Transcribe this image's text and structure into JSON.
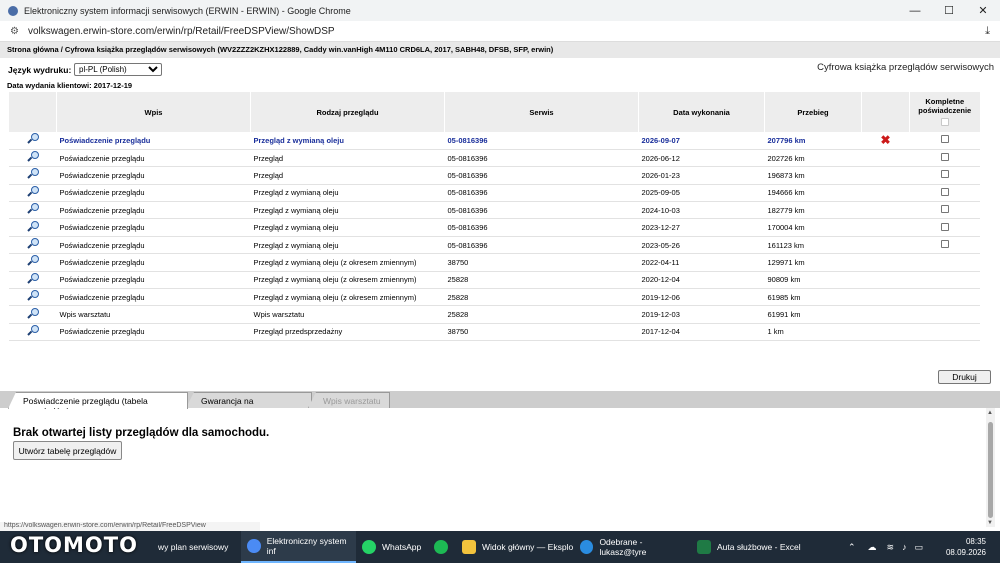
{
  "window": {
    "title": "Elektroniczny system informacji serwisowych (ERWIN - ERWIN) - Google Chrome",
    "controls": {
      "minimize": "—",
      "maximize": "☐",
      "close": "✕"
    }
  },
  "address": {
    "url": "volkswagen.erwin-store.com/erwin/rp/Retail/FreeDSPView/ShowDSP"
  },
  "breadcrumb": "Strona główna / Cyfrowa książka przeglądów serwisowych (WV2ZZZ2KZHX122889, Caddy win.vanHigh 4M110 CRD6LA, 2017, SABH48, DFSB, SFP, erwin)",
  "language": {
    "label": "Język wydruku:",
    "selected": "pl-PL (Polish)"
  },
  "document_title": "Cyfrowa książka przeglądów serwisowych",
  "issue_date": "Data wydania klientowi: 2017-12-19",
  "table": {
    "headers": {
      "wpis": "Wpis",
      "rodzaj": "Rodzaj przeglądu",
      "serwis": "Serwis",
      "data": "Data wykonania",
      "przebieg": "Przebieg",
      "kompletne": "Kompletne poświadczenie"
    },
    "rows": [
      {
        "wpis": "Poświadczenie przeglądu",
        "rodzaj": "Przegląd z wymianą oleju",
        "serwis": "05-0816396",
        "data": "2026-09-07",
        "przebieg": "207796 km",
        "delete": "✖",
        "checkbox": true
      },
      {
        "wpis": "Poświadczenie przeglądu",
        "rodzaj": "Przegląd",
        "serwis": "05-0816396",
        "data": "2026-06-12",
        "przebieg": "202726 km",
        "checkbox": true
      },
      {
        "wpis": "Poświadczenie przeglądu",
        "rodzaj": "Przegląd",
        "serwis": "05-0816396",
        "data": "2026-01-23",
        "przebieg": "196873 km",
        "checkbox": true
      },
      {
        "wpis": "Poświadczenie przeglądu",
        "rodzaj": "Przegląd z wymianą oleju",
        "serwis": "05-0816396",
        "data": "2025-09-05",
        "przebieg": "194666 km",
        "checkbox": true
      },
      {
        "wpis": "Poświadczenie przeglądu",
        "rodzaj": "Przegląd z wymianą oleju",
        "serwis": "05-0816396",
        "data": "2024-10-03",
        "przebieg": "182779 km",
        "checkbox": true
      },
      {
        "wpis": "Poświadczenie przeglądu",
        "rodzaj": "Przegląd z wymianą oleju",
        "serwis": "05-0816396",
        "data": "2023-12-27",
        "przebieg": "170004 km",
        "checkbox": true
      },
      {
        "wpis": "Poświadczenie przeglądu",
        "rodzaj": "Przegląd z wymianą oleju",
        "serwis": "05-0816396",
        "data": "2023-05-26",
        "przebieg": "161123 km",
        "checkbox": true
      },
      {
        "wpis": "Poświadczenie przeglądu",
        "rodzaj": "Przegląd z wymianą oleju (z okresem zmiennym)",
        "serwis": "38750",
        "data": "2022-04-11",
        "przebieg": "129971 km",
        "checkbox": false
      },
      {
        "wpis": "Poświadczenie przeglądu",
        "rodzaj": "Przegląd z wymianą oleju (z okresem zmiennym)",
        "serwis": "25828",
        "data": "2020-12-04",
        "przebieg": "90809 km",
        "checkbox": false
      },
      {
        "wpis": "Poświadczenie przeglądu",
        "rodzaj": "Przegląd z wymianą oleju (z okresem zmiennym)",
        "serwis": "25828",
        "data": "2019-12-06",
        "przebieg": "61985 km",
        "checkbox": false
      },
      {
        "wpis": "Wpis warsztatu",
        "rodzaj": "Wpis warsztatu",
        "serwis": "25828",
        "data": "2019-12-03",
        "przebieg": "61991 km",
        "checkbox": false
      },
      {
        "wpis": "Poświadczenie przeglądu",
        "rodzaj": "Przegląd przedsprzedażny",
        "serwis": "38750",
        "data": "2017-12-04",
        "przebieg": "1 km",
        "checkbox": false
      }
    ]
  },
  "print_button": "Drukuj",
  "tabs": [
    {
      "label": "Poświadczenie przeglądu (tabela przeglądów)",
      "state": "active"
    },
    {
      "label": "Gwarancja na przerdzewienia",
      "state": "normal"
    },
    {
      "label": "Wpis warsztatu",
      "state": "disabled"
    }
  ],
  "panel": {
    "message": "Brak otwartej listy przeglądów dla samochodu.",
    "create_button": "Utwórz tabelę przeglądów"
  },
  "status_url": "https://volkswagen.erwin-store.com/erwin/rp/Retail/FreeDSPView",
  "watermark": "OTOMOTO",
  "taskbar": {
    "items": [
      {
        "label": "wy plan serwisowy",
        "icon": "document-icon",
        "color": "#d94f3d"
      },
      {
        "label": "Elektroniczny system inf",
        "icon": "chrome-icon",
        "color": "#4b8bf4"
      },
      {
        "label": "WhatsApp",
        "icon": "whatsapp-icon",
        "color": "#25d366"
      },
      {
        "label": "",
        "icon": "spotify-icon",
        "color": "#1db954"
      },
      {
        "label": "Widok główny — Eksplo",
        "icon": "folder-icon",
        "color": "#f2c33d"
      },
      {
        "label": "Odebrane - lukasz@tyre",
        "icon": "edge-icon",
        "color": "#2a8ce0"
      },
      {
        "label": "Auta służbowe - Excel",
        "icon": "excel-icon",
        "color": "#1f7a45"
      }
    ],
    "time": "08:35",
    "date": "08.09.2026"
  }
}
